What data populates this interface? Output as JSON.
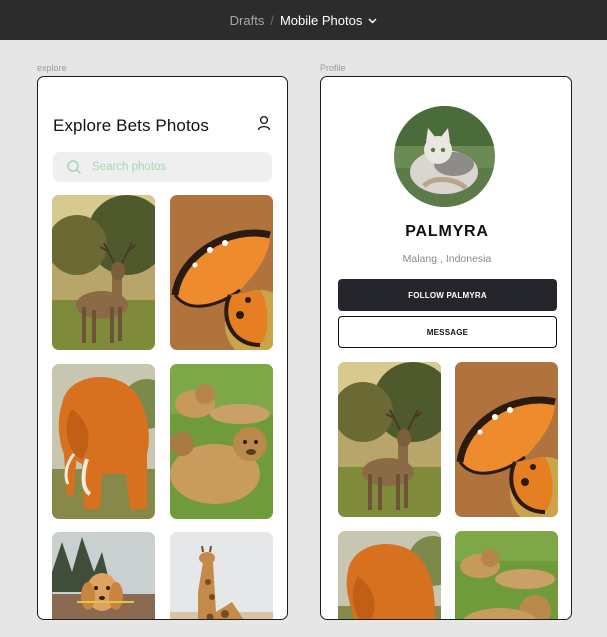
{
  "topbar": {
    "breadcrumb_parent": "Drafts",
    "separator": "/",
    "breadcrumb_current": "Mobile Photos",
    "dropdown_icon": "chevron-down-icon"
  },
  "frames": {
    "explore_label": "explore",
    "profile_label": "Profile"
  },
  "explore": {
    "title": "Explore Bets Photos",
    "user_icon": "user-icon",
    "search": {
      "placeholder": "Search photos",
      "value": "",
      "icon": "search-icon"
    },
    "photos": [
      "deer",
      "butterfly",
      "elephant",
      "lions",
      "dog",
      "giraffe"
    ]
  },
  "profile": {
    "avatar": "cat-avatar",
    "name": "PALMYRA",
    "location": "Malang , Indonesia",
    "follow_button": "FOLLOW PALMYRA",
    "message_button": "MESSAGE",
    "photos": [
      "deer",
      "butterfly",
      "elephant",
      "lions"
    ]
  },
  "colors": {
    "topbar_bg": "#2c2c2c",
    "canvas_bg": "#e6e6e6",
    "button_dark": "#25262b",
    "search_accent": "#a7d6ae"
  }
}
